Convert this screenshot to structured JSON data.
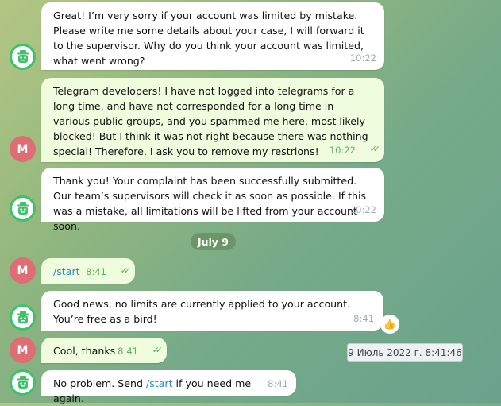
{
  "messages": [
    {
      "from": "bot",
      "text": "Great! I’m very sorry if your account was limited by mistake. Please write me some details about your case, I will forward it to the supervisor. Why do you think your account was limited, what went wrong?",
      "time": "10:22"
    },
    {
      "from": "user",
      "avatar_letter": "M",
      "text": "Telegram developers! I have not logged into telegrams for a long time, and have not corresponded for a long time in various public groups, and you spammed me here, most likely blocked! But I think it was not right because there was nothing special! Therefore, I ask you to remove my restrions!",
      "time": "10:22",
      "status": "read"
    },
    {
      "from": "bot",
      "text": "Thank you! Your complaint has been successfully submitted. Our team’s supervisors will check it as soon as possible. If this was a mistake, all limitations will be lifted from your account soon.",
      "time": "10:22"
    },
    {
      "from": "user",
      "avatar_letter": "M",
      "text": "/start",
      "time": "8:41",
      "status": "read"
    },
    {
      "from": "bot",
      "text": "Good news, no limits are currently applied to your account. You’re free as a bird!",
      "time": "8:41",
      "reaction": "👍"
    },
    {
      "from": "user",
      "avatar_letter": "M",
      "text": "Cool, thanks",
      "time": "8:41",
      "status": "read"
    },
    {
      "from": "bot",
      "text_before": "No problem. Send ",
      "link": "/start",
      "text_after": " if you need me again.",
      "time": "8:41"
    }
  ],
  "date_separator": "July 9",
  "timestamp_tooltip": "9 Июль 2022 г. 8:41:46",
  "colors": {
    "incoming": "#ffffff",
    "outgoing": "#effdde",
    "link": "#2f86c9",
    "avatar_user": "#e06c74",
    "avatar_bot_ring": "#3fc16c"
  }
}
